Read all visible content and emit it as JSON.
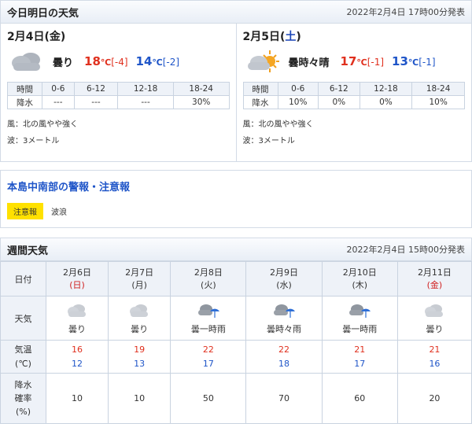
{
  "today_section": {
    "title": "今日明日の天気",
    "issued": "2022年2月4日 17時00分発表"
  },
  "days": [
    {
      "date": "2月4日",
      "dow": "金",
      "icon": "cloudy-icon",
      "weather": "曇り",
      "high": "18",
      "high_diff": "[-4]",
      "low": "14",
      "low_diff": "[-2]",
      "temp_unit": "℃",
      "rain_header_label": "時間",
      "rain_row_label": "降水",
      "rain_periods": [
        "0-6",
        "6-12",
        "12-18",
        "18-24"
      ],
      "rain_values": [
        "---",
        "---",
        "---",
        "30%"
      ],
      "wind": "風：北の風やや強く",
      "wave": "波：3メートル"
    },
    {
      "date": "2月5日",
      "dow": "土",
      "icon": "cloudy-sunny-icon",
      "weather": "曇時々晴",
      "high": "17",
      "high_diff": "[-1]",
      "low": "13",
      "low_diff": "[-1]",
      "temp_unit": "℃",
      "rain_header_label": "時間",
      "rain_row_label": "降水",
      "rain_periods": [
        "0-6",
        "6-12",
        "12-18",
        "18-24"
      ],
      "rain_values": [
        "10%",
        "0%",
        "0%",
        "10%"
      ],
      "wind": "風：北の風やや強く",
      "wave": "波：3メートル"
    }
  ],
  "warnings": {
    "title": "本島中南部の警報・注意報",
    "badge": "注意報",
    "type": "波浪"
  },
  "weekly_section": {
    "title": "週間天気",
    "issued": "2022年2月4日 15時00分発表"
  },
  "weekly": {
    "row_labels": {
      "date": "日付",
      "weather": "天気",
      "temp_line1": "気温",
      "temp_line2": "(℃)",
      "pop_line1": "降水",
      "pop_line2": "確率",
      "pop_line3": "(%)"
    },
    "days": [
      {
        "date": "2月6日",
        "dow": "(日)",
        "icon": "cloudy-icon",
        "weather": "曇り",
        "high": "16",
        "low": "12",
        "pop": "10"
      },
      {
        "date": "2月7日",
        "dow": "(月)",
        "icon": "cloudy-icon",
        "weather": "曇り",
        "high": "19",
        "low": "13",
        "pop": "10"
      },
      {
        "date": "2月8日",
        "dow": "(火)",
        "icon": "cloudy-umbrella-icon",
        "weather": "曇一時雨",
        "high": "22",
        "low": "17",
        "pop": "50"
      },
      {
        "date": "2月9日",
        "dow": "(水)",
        "icon": "cloudy-umbrella-icon",
        "weather": "曇時々雨",
        "high": "22",
        "low": "18",
        "pop": "70"
      },
      {
        "date": "2月10日",
        "dow": "(木)",
        "icon": "cloudy-umbrella-icon",
        "weather": "曇一時雨",
        "high": "21",
        "low": "17",
        "pop": "60"
      },
      {
        "date": "2月11日",
        "dow": "(金)",
        "icon": "cloudy-icon",
        "weather": "曇り",
        "high": "21",
        "low": "16",
        "pop": "20"
      }
    ]
  },
  "colors": {
    "high": "#e0301e",
    "low": "#1f55c8",
    "sunday_holiday": "#d02020",
    "saturday": "#1a45b8",
    "badge": "#ffe100"
  }
}
